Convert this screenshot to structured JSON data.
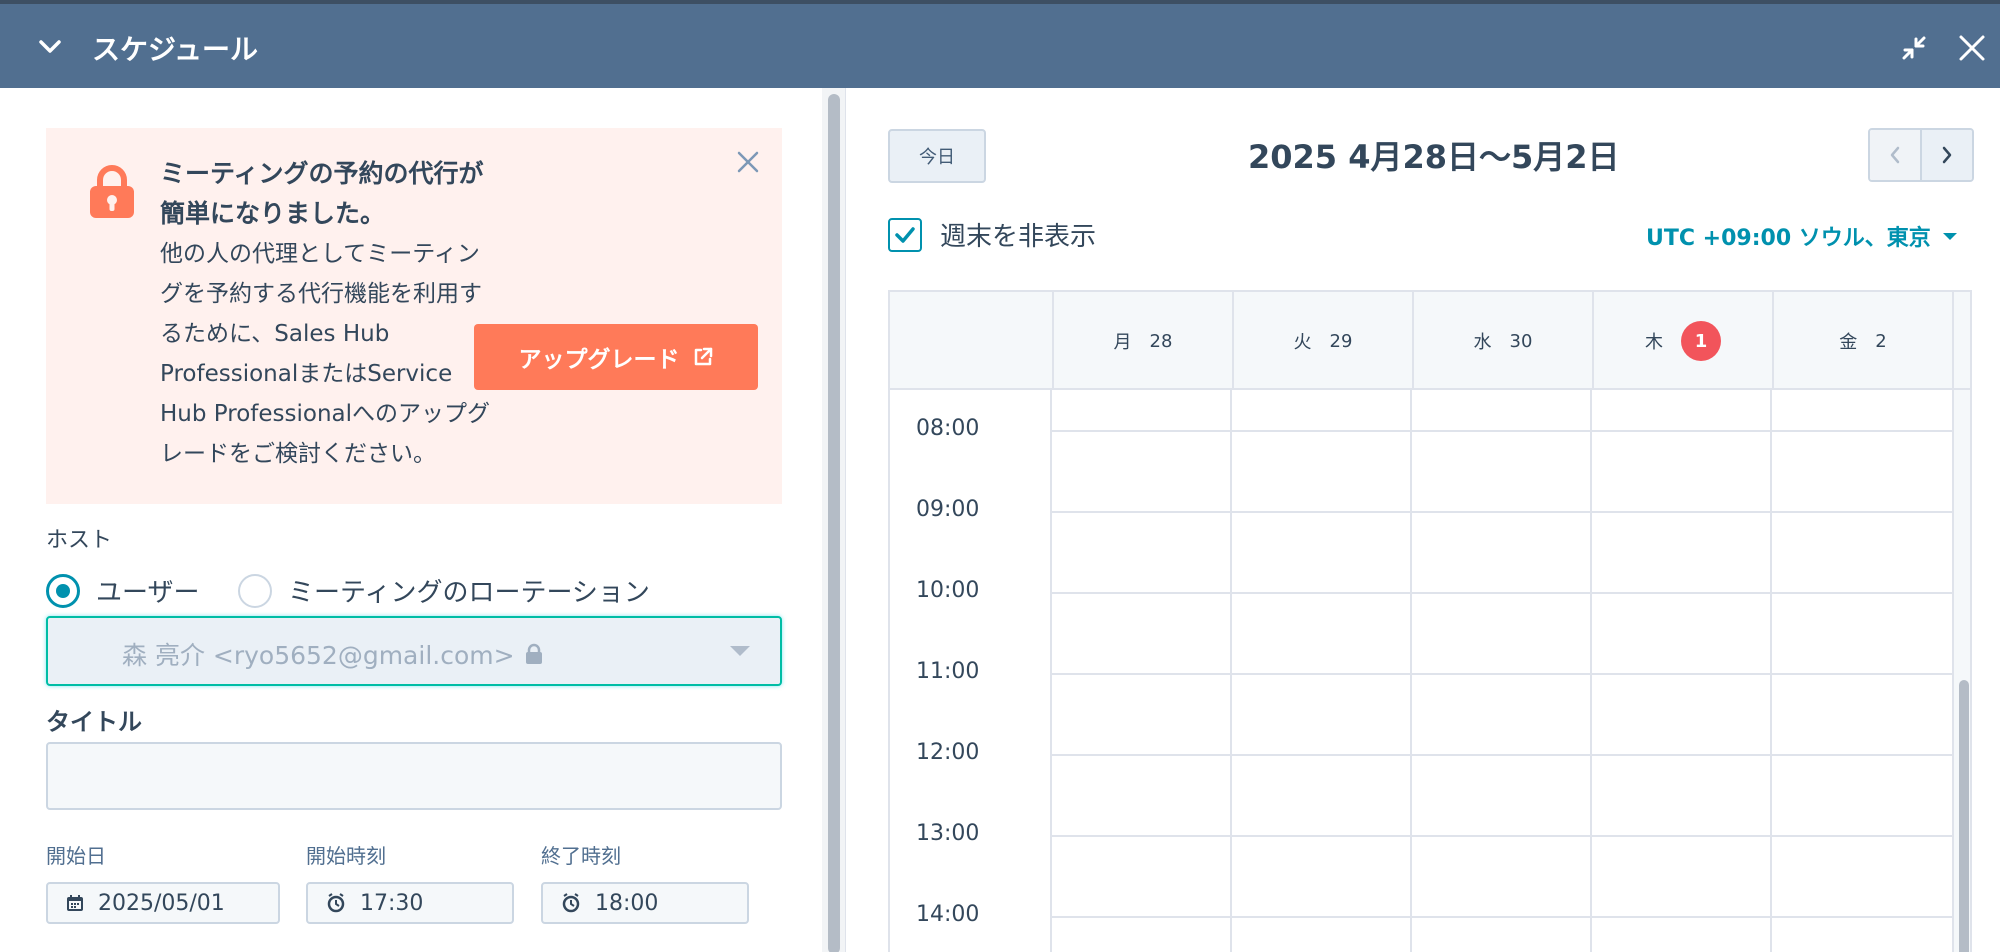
{
  "header": {
    "title": "スケジュール",
    "icons": [
      "chevron-down-icon",
      "compress-icon",
      "close-icon"
    ]
  },
  "banner": {
    "title": "ミーティングの予約の代行が簡単になりました。",
    "body": "他の人の代理としてミーティングを予約する代行機能を利用するために、Sales Hub ProfessionalまたはService Hub Professionalへのアップグレードをご検討ください。",
    "upgrade_label": "アップグレード",
    "icon": "lock-icon",
    "accent": "#ff7a59"
  },
  "host": {
    "label": "ホスト",
    "options": [
      {
        "label": "ユーザー",
        "selected": true
      },
      {
        "label": "ミーティングのローテーション",
        "selected": false
      }
    ],
    "user_value": "森 亮介 <ryo5652@gmail.com>"
  },
  "title_field": {
    "label": "タイトル",
    "value": ""
  },
  "date_fields": {
    "start_date_label": "開始日",
    "start_date": "2025/05/01",
    "start_time_label": "開始時刻",
    "start_time": "17:30",
    "end_time_label": "終了時刻",
    "end_time": "18:00"
  },
  "calendar": {
    "today_label": "今日",
    "week_title": "2025 4月28日〜5月2日",
    "hide_weekend_label": "週末を非表示",
    "hide_weekend_checked": true,
    "timezone": "UTC +09:00 ソウル、東京",
    "days": [
      {
        "dow": "月",
        "date": "28",
        "today": false
      },
      {
        "dow": "火",
        "date": "29",
        "today": false
      },
      {
        "dow": "水",
        "date": "30",
        "today": false
      },
      {
        "dow": "木",
        "date": "1",
        "today": true
      },
      {
        "dow": "金",
        "date": "2",
        "today": false
      }
    ],
    "times": [
      "08:00",
      "09:00",
      "10:00",
      "11:00",
      "12:00",
      "13:00",
      "14:00"
    ],
    "today_color": "#f2545b"
  }
}
